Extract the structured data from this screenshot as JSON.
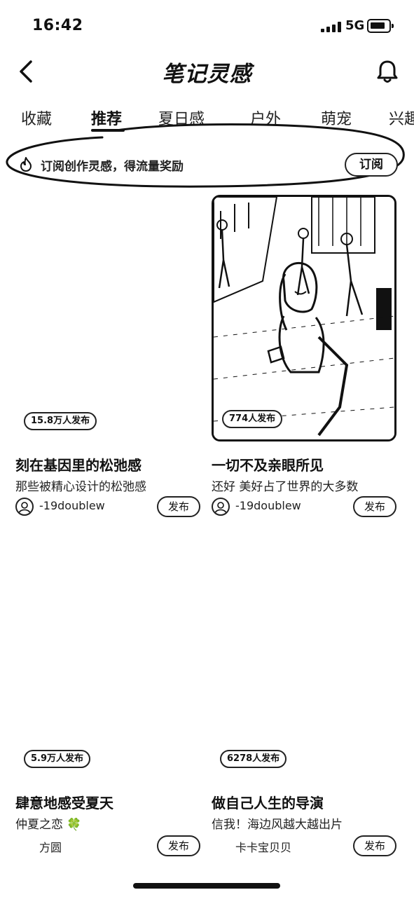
{
  "status_bar": {
    "time": "16:42",
    "network": "5G"
  },
  "header": {
    "title": "笔记灵感"
  },
  "tabs": [
    {
      "label": "收藏",
      "active": false
    },
    {
      "label": "推荐",
      "active": true
    },
    {
      "label": "夏日感",
      "active": false
    },
    {
      "label": "户外",
      "active": false
    },
    {
      "label": "萌宠",
      "active": false
    },
    {
      "label": "兴趣",
      "active": false
    }
  ],
  "banner": {
    "text": "订阅创作灵感，得流量奖励",
    "button_label": "订阅"
  },
  "cards": [
    {
      "badge": "15.8万人发布",
      "title": "刻在基因里的松弛感",
      "subtitle": "那些被精心设计的松弛感",
      "author": "-19doublew",
      "publish_label": "发布"
    },
    {
      "badge": "774人发布",
      "title": "一切不及亲眼所见",
      "subtitle": "还好 美好占了世界的大多数",
      "author": "-19doublew",
      "publish_label": "发布"
    },
    {
      "badge": "5.9万人发布",
      "title": "肆意地感受夏天",
      "subtitle": "仲夏之恋 🍀",
      "author": "方圆",
      "publish_label": "发布"
    },
    {
      "badge": "6278人发布",
      "title": "做自己人生的导演",
      "subtitle": "信我！海边风越大越出片",
      "author": "卡卡宝贝贝",
      "publish_label": "发布"
    }
  ]
}
